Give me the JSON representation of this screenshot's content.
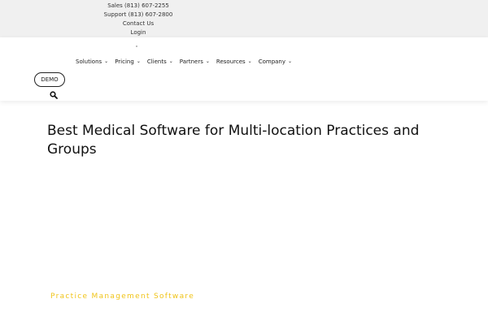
{
  "topbar": {
    "sales": "Sales (813) 607-2255",
    "support": "Support (813) 607-2800",
    "contact": "Contact Us",
    "login": "Login"
  },
  "nav": {
    "items": [
      {
        "label": "Solutions"
      },
      {
        "label": "Pricing"
      },
      {
        "label": "Clients"
      },
      {
        "label": "Partners"
      },
      {
        "label": "Resources"
      },
      {
        "label": "Company"
      }
    ],
    "chevron": "⌄"
  },
  "demo_button": "DEMO",
  "icons": {
    "search": "search-icon",
    "chevron": "chevron-down-icon"
  },
  "hero": {
    "title": "Best Medical Software for Multi-location Practices and Groups",
    "subtitle": "Practice Management Software"
  },
  "colors": {
    "topbar_bg": "#f0f0f0",
    "accent_yellow": "#f0c419",
    "text": "#111111"
  }
}
